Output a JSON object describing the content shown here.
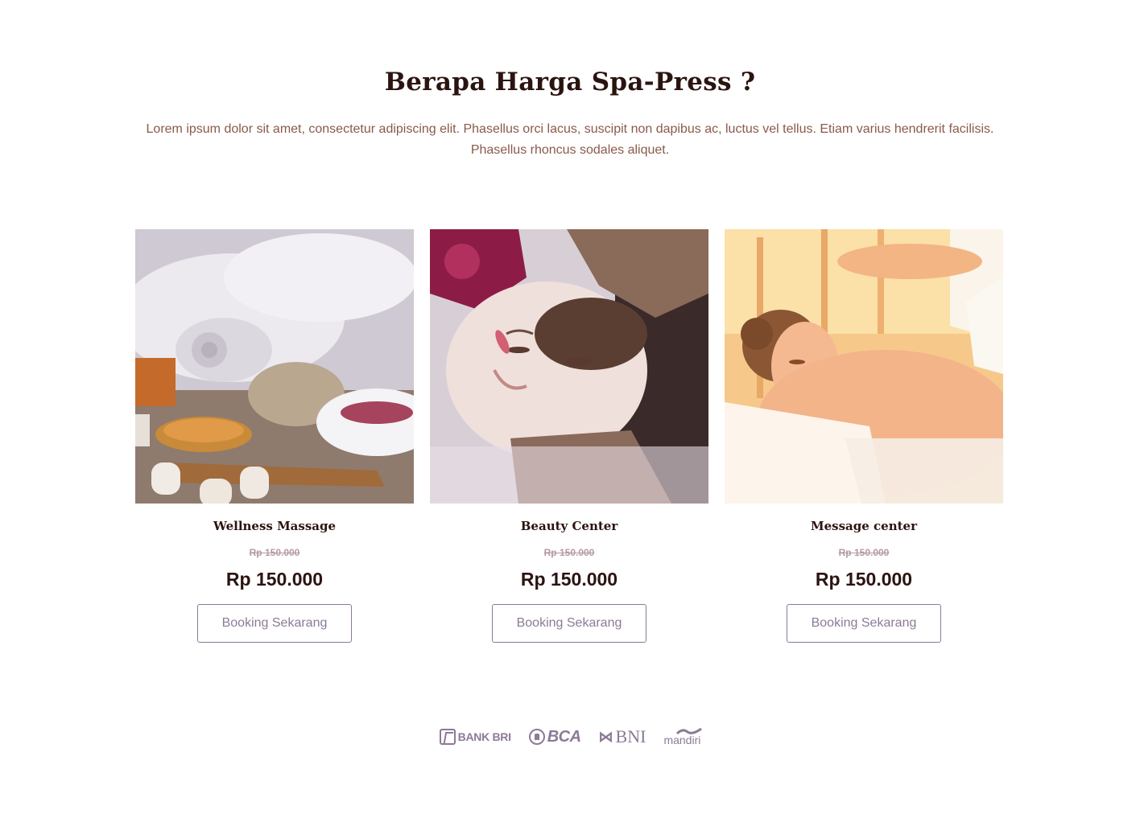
{
  "section": {
    "title": "Berapa Harga Spa-Press ?",
    "description": "Lorem ipsum dolor sit amet, consectetur adipiscing elit. Phasellus orci lacus, suscipit non dapibus ac, luctus vel tellus. Etiam varius hendrerit facilisis. Phasellus rhoncus sodales aliquet."
  },
  "cards": [
    {
      "name": "Wellness Massage",
      "old_price": "Rp 150.000",
      "price": "Rp 150.000",
      "button": "Booking Sekarang"
    },
    {
      "name": "Beauty Center",
      "old_price": "Rp 150.000",
      "price": "Rp 150.000",
      "button": "Booking Sekarang"
    },
    {
      "name": "Message center",
      "old_price": "Rp 150.000",
      "price": "Rp 150.000",
      "button": "Booking Sekarang"
    }
  ],
  "banks": {
    "bri": "BANK BRI",
    "bca": "BCA",
    "bni": "BNI",
    "mandiri": "mandiri"
  },
  "colors": {
    "heading": "#2b1410",
    "body_text": "#8a5a4a",
    "old_price": "#b49aa0",
    "accent": "#8d7a96"
  }
}
